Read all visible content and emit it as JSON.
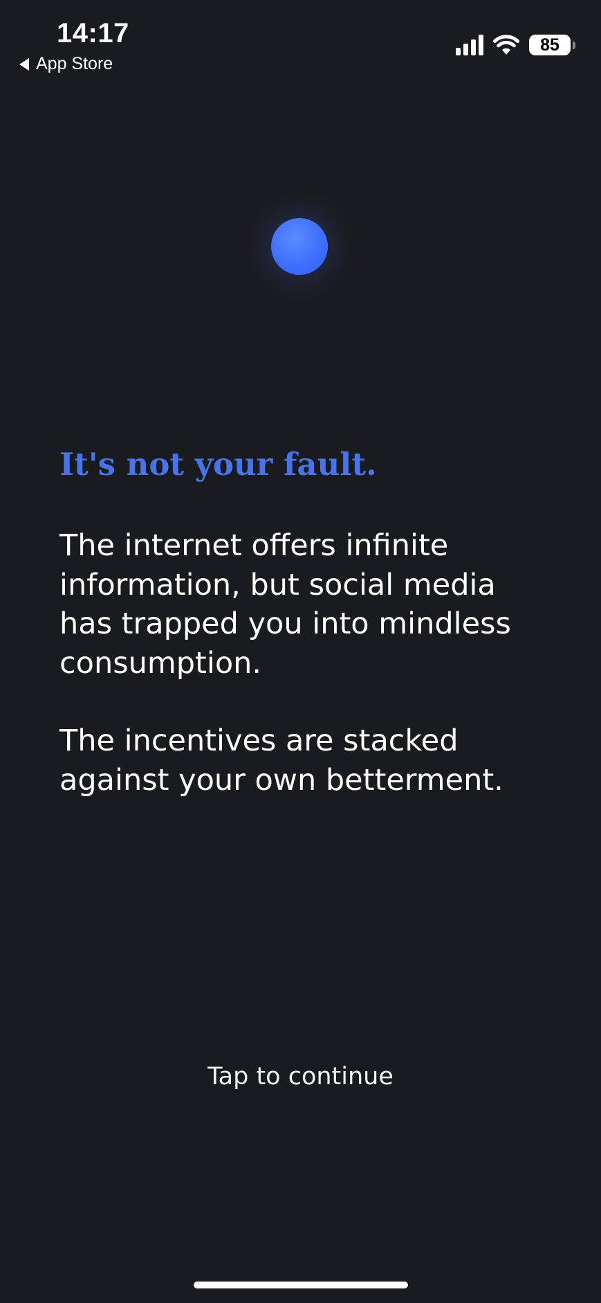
{
  "status_bar": {
    "time": "14:17",
    "back_label": "App Store",
    "battery_level": "85",
    "signal_bars": 4
  },
  "onboarding": {
    "headline": "It's not your fault.",
    "paragraph1": "The internet offers infinite information, but social media has trapped you into mindless consumption.",
    "paragraph2": "The incentives are stacked against your own betterment.",
    "continue_label": "Tap to continue"
  },
  "colors": {
    "background": "#1a1b1f",
    "accent": "#4774ea",
    "orb": "#3f6fff"
  },
  "icons": {
    "orb": "glowing-orb-icon",
    "back": "back-arrow-icon",
    "signal": "cellular-signal-icon",
    "wifi": "wifi-icon",
    "battery": "battery-icon"
  }
}
